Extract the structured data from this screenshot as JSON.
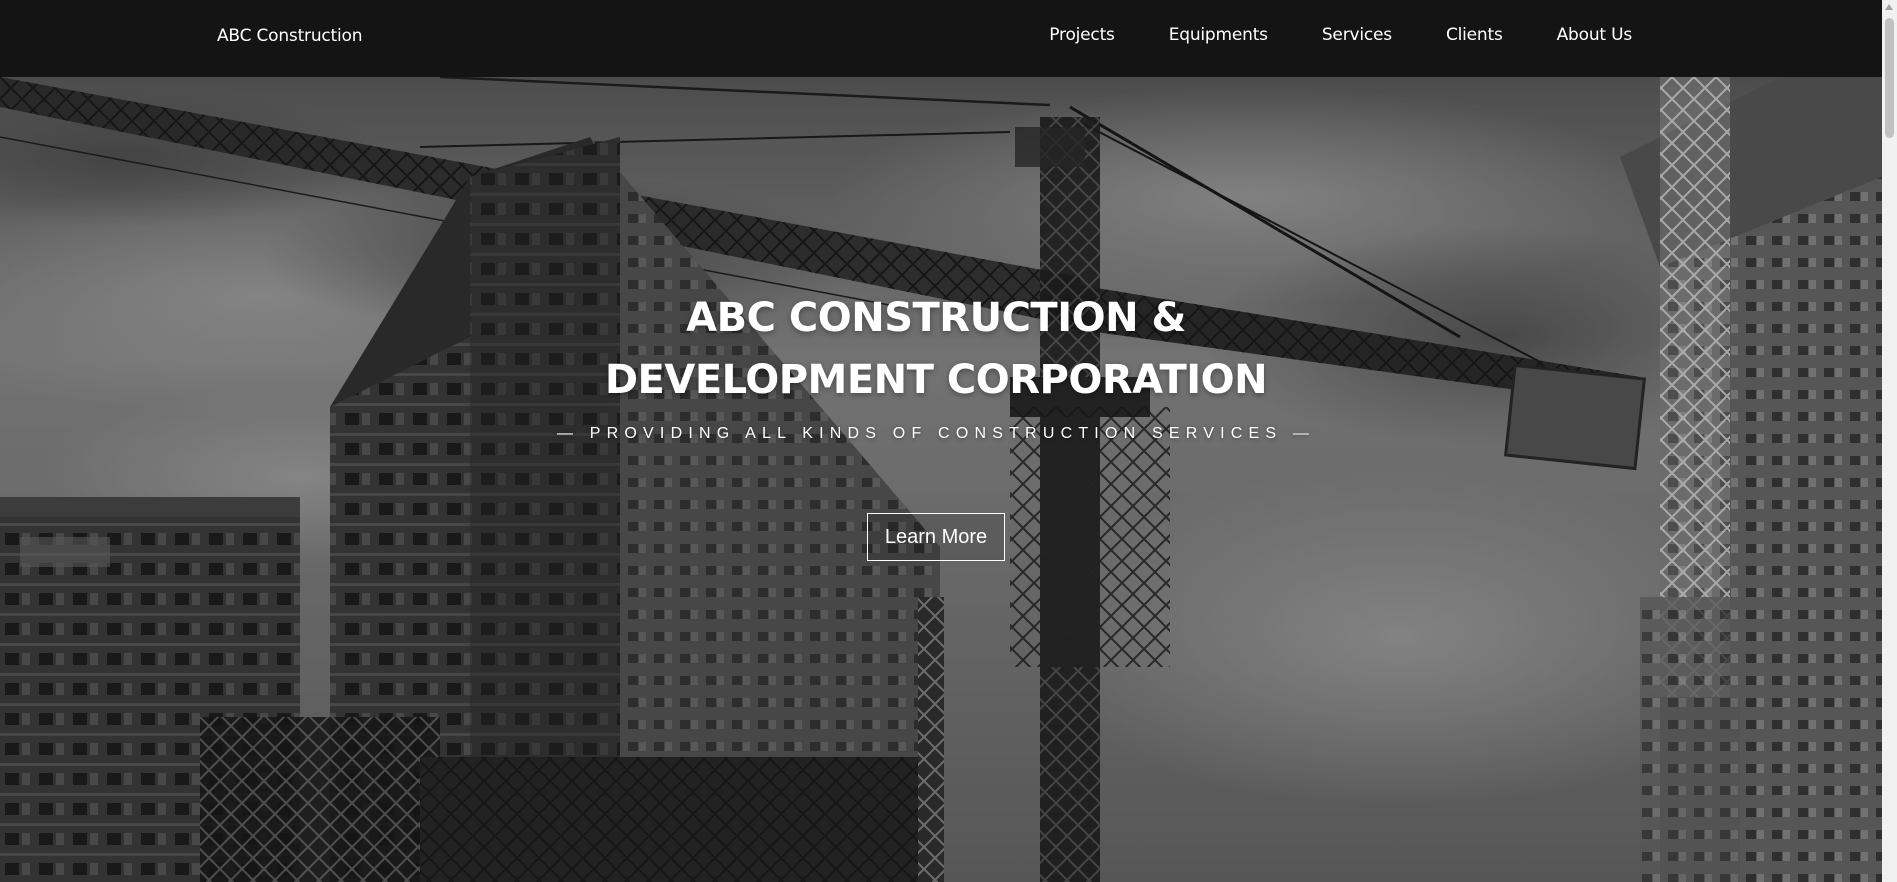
{
  "navbar": {
    "brand": "ABC Construction",
    "links": [
      {
        "label": "Projects"
      },
      {
        "label": "Equipments"
      },
      {
        "label": "Services"
      },
      {
        "label": "Clients"
      },
      {
        "label": "About Us"
      }
    ],
    "background": "#141414"
  },
  "hero": {
    "title_line1": "ABC CONSTRUCTION &",
    "title_line2": "DEVELOPMENT CORPORATION",
    "subtitle": "— PROVIDING ALL KINDS OF CONSTRUCTION SERVICES —",
    "cta_label": "Learn More",
    "background_image": "grayscale-construction-site-cranes-buildings"
  },
  "colors": {
    "text": "#ffffff",
    "nav_bg": "#141414"
  }
}
